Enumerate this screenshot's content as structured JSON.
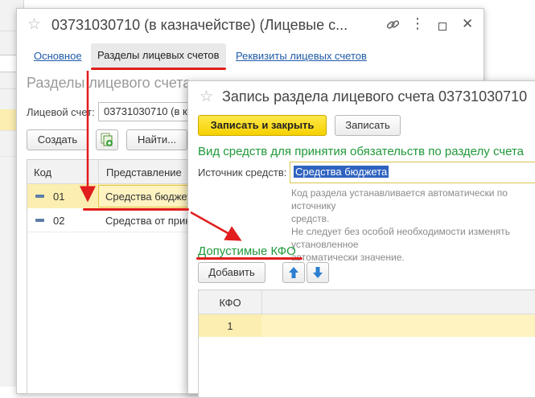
{
  "window_main": {
    "title": "03731030710 (в казначействе) (Лицевые с...",
    "tabs": [
      {
        "label": "Основное"
      },
      {
        "label": "Разделы лицевых счетов"
      },
      {
        "label": "Реквизиты лицевых счетов"
      }
    ],
    "section_heading": "Разделы лицевого счета",
    "account_label": "Лицевой счет:",
    "account_value": "03731030710 (в к",
    "buttons": {
      "create": "Создать",
      "find": "Найти..."
    },
    "table": {
      "columns": [
        "Код",
        "Представление"
      ],
      "rows": [
        {
          "code": "01",
          "name": "Средства бюджета"
        },
        {
          "code": "02",
          "name": "Средства от приносящей доход деятельности"
        }
      ]
    }
  },
  "window_record": {
    "title": "Запись раздела лицевого счета 03731030710",
    "buttons": {
      "save_close": "Записать и закрыть",
      "save": "Записать"
    },
    "group_title": "Вид средств для принятия обязательств по разделу счета",
    "source_label": "Источник средств:",
    "source_value": "Средства бюджета",
    "hint_lines": [
      "Код раздела устанавливается автоматически по источнику",
      "средств.",
      "Не следует без особой необходимости изменять установленное",
      "автоматически значение."
    ],
    "kfo_title": "Допустимые КФО",
    "add_button": "Добавить",
    "kfo_table": {
      "columns": [
        "КФО"
      ],
      "rows": [
        {
          "kfo": "1"
        }
      ]
    }
  },
  "colors": {
    "accent_yellow": "#f6d100",
    "link_blue": "#1f5aa8",
    "group_green": "#20993a",
    "annotation_red": "#e11d1d",
    "row_highlight": "#fbeeb0"
  }
}
